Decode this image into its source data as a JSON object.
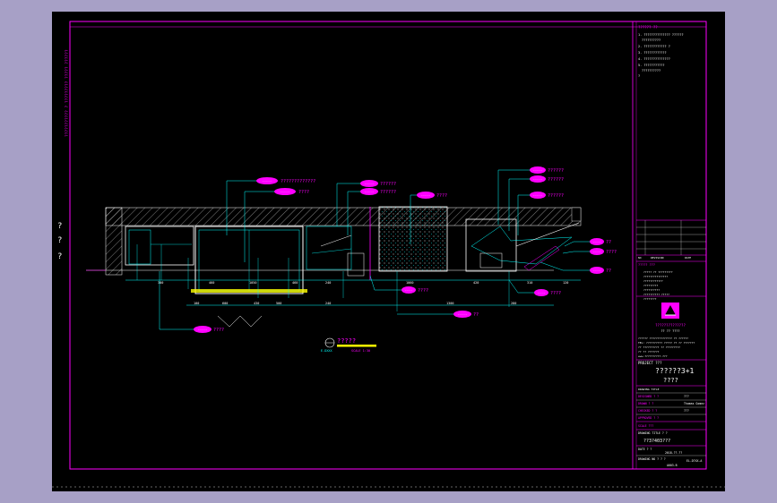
{
  "sheet": {
    "left_margin_text": "??????????? ? ????????? ????? ??????",
    "left_marks": [
      "?",
      "?",
      "?"
    ],
    "notes_header": "?????? ??",
    "notes": [
      "1. ?????????????? ??????",
      "??????????",
      "2. ???????????? ?",
      "3. ????????????",
      "4. ??????????????",
      "5. ???????????",
      "??????????",
      "?"
    ]
  },
  "drawing": {
    "callouts_left": [
      {
        "tag": "-----",
        "text": "?????????????"
      },
      {
        "tag": "-----",
        "text": "????"
      }
    ],
    "callouts_mid": [
      {
        "tag": "-----",
        "text": "??????"
      },
      {
        "tag": "-----",
        "text": "??????"
      },
      {
        "tag": "-----",
        "text": "????"
      }
    ],
    "callouts_right": [
      {
        "tag": "-----",
        "text": "??????"
      },
      {
        "tag": "-----",
        "text": "??????"
      },
      {
        "tag": "-----",
        "text": "??????"
      }
    ],
    "callouts_far_right": [
      {
        "tag": "----",
        "text": "??"
      },
      {
        "tag": "----",
        "text": "????"
      },
      {
        "tag": "----",
        "text": "??"
      },
      {
        "tag": "----",
        "text": "????"
      }
    ],
    "bottom_callouts": [
      {
        "tag": "-----",
        "text": "????"
      },
      {
        "tag": "-----",
        "text": "??"
      },
      {
        "tag": "----",
        "text": "????"
      }
    ],
    "dims_top": [
      "300",
      "460",
      "1050",
      "460",
      "240",
      "1060",
      "420",
      "310",
      "120"
    ],
    "dims_bottom": [
      "100",
      "600",
      "430",
      "500",
      "240",
      "1300",
      "280"
    ],
    "section_title": "?????",
    "section_scale": "SCALE 1:30",
    "section_code": "E-DXXX"
  },
  "title_block": {
    "revision_header": [
      "NO",
      "REVISION",
      "DATE"
    ],
    "revision_label": "REV. / ???? ???",
    "issue_label": "DATE ?",
    "issue_notes_header": "????? ???",
    "issue_notes": [
      "????? ?? ?????????",
      "???????????????",
      "????????????",
      "?????????",
      "??????????",
      "?????????? ?????",
      "????????"
    ],
    "company_name": "??????????????",
    "company_sub": "?? ?? ????",
    "company_address": [
      "?????? ?????????????? ?? ??????",
      "TEL: ?????????? ????? ?? ?? ???????",
      "?? ?????????? ?? ?????????",
      "?? ?? ???????",
      "www.??????????.???"
    ],
    "project_label": "PROJECT ???",
    "project_name": "??????3+1",
    "project_sub": "????",
    "drawing_title_label": "DRAWING TITLE",
    "rows": [
      {
        "label": "DESIGNED ? ?",
        "value": "???"
      },
      {
        "label": "DRAWN ? ?",
        "value": "Thomas Gomez"
      },
      {
        "label": "CHECKED ? ?",
        "value": "???"
      },
      {
        "label": "APPROVED ? ?",
        "value": ""
      }
    ],
    "scale_label": "SCALE ???",
    "drawing_name_label": "DRAWING TITLE ? ?",
    "drawing_name": "??3?403???",
    "date_label": "DATE ? ?",
    "date_value": "2018.??.??",
    "drawing_no_label": "DRAWING NO ? ? ?",
    "drawing_no": "EL-D?XX-A",
    "sheet_no": "A003-B"
  },
  "colors": {
    "frame": "#ff00ff",
    "lines": "#00ffff",
    "walls": "#ffffff",
    "accent": "#ffff00",
    "background": "#000000"
  }
}
